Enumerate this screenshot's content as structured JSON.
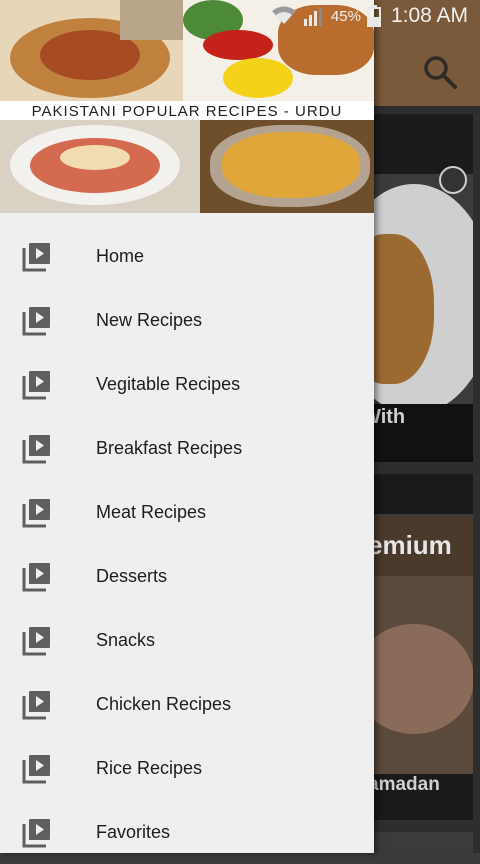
{
  "status_bar": {
    "battery_percent": "45%",
    "time": "1:08 AM",
    "icons": [
      "wifi-icon",
      "signal-icon",
      "battery-icon"
    ]
  },
  "drawer": {
    "header_title": "PAKISTANI POPULAR RECIPES - URDU",
    "menu_icon": "video-library-icon",
    "items": [
      {
        "label": "Home"
      },
      {
        "label": "New Recipes"
      },
      {
        "label": "Vegitable Recipes"
      },
      {
        "label": "Breakfast Recipes"
      },
      {
        "label": "Meat Recipes"
      },
      {
        "label": "Desserts"
      },
      {
        "label": "Snacks"
      },
      {
        "label": "Chicken Recipes"
      },
      {
        "label": "Rice Recipes"
      },
      {
        "label": "Favorites"
      }
    ]
  },
  "background": {
    "toolbar_icon": "search-icon",
    "card1_caption": "With",
    "card2_overlay": "emium",
    "card2_caption": "amadan"
  },
  "colors": {
    "toolbar": "#7a5a3a",
    "drawer_bg": "#efefef",
    "icon_gray": "#5f5f5f"
  }
}
